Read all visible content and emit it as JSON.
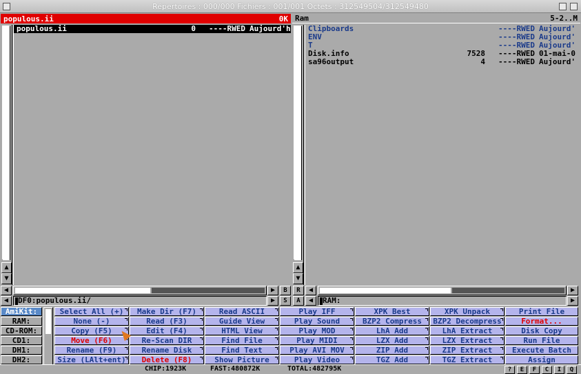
{
  "titlebar": {
    "text": "Répertoires : 000/000   Fichiers : 001/001   Octets : 312549504/312549480"
  },
  "left": {
    "title": "populous.ii",
    "size": "0K",
    "path": "DF0:populous.ii/",
    "files": [
      {
        "name": "populous.ii",
        "size": "0",
        "prot": "----RWED",
        "date": "Aujourd'h",
        "selected": true,
        "dir": false
      }
    ]
  },
  "right": {
    "title": "Ram",
    "size": "5-2..M",
    "path": "RAM:",
    "files": [
      {
        "name": "Clipboards",
        "size": "",
        "prot": "----RWED",
        "date": "Aujourd'",
        "dir": true
      },
      {
        "name": "ENV",
        "size": "",
        "prot": "----RWED",
        "date": "Aujourd'",
        "dir": true
      },
      {
        "name": "T",
        "size": "",
        "prot": "----RWED",
        "date": "Aujourd'",
        "dir": true
      },
      {
        "name": "Disk.info",
        "size": "7528",
        "prot": "----RWED",
        "date": "01-mai-0",
        "dir": false
      },
      {
        "name": "sa96output",
        "size": "4",
        "prot": "----RWED",
        "date": "Aujourd'",
        "dir": false
      }
    ]
  },
  "middle_buttons": [
    "B",
    "R",
    "S",
    "A"
  ],
  "devices": [
    "AmiKit:",
    "RAM:",
    "CD-ROM:",
    "CD1:",
    "DH1:",
    "DH2:"
  ],
  "buttons": [
    [
      "Select All (+)",
      "None (-)",
      "Copy (F5)",
      "Move (F6)",
      "Rename (F9)",
      "Size (LAlt+ent)"
    ],
    [
      "Make Dir (F7)",
      "Read (F3)",
      "Edit (F4)",
      "Re-Scan DIR",
      "Rename Disk",
      "Delete (F8)"
    ],
    [
      "Read ASCII",
      "Guide View",
      "HTML View",
      "Find File",
      "Find Text",
      "Show Picture"
    ],
    [
      "Play IFF",
      "Play Sound",
      "Play MOD",
      "Play MIDI",
      "Play AVI MOV",
      "Play Video"
    ],
    [
      "XPK Best",
      "BZP2 Compress",
      "LhA Add",
      "LZX Add",
      "ZIP Add",
      "TGZ Add"
    ],
    [
      "XPK Unpack",
      "BZP2 Decompress",
      "LhA Extract",
      "LZX Extract",
      "ZIP Extract",
      "TGZ Extract"
    ],
    [
      "Print File",
      "Format...",
      "Disk Copy",
      "Run File",
      "Execute Batch",
      "Assign"
    ]
  ],
  "button_colors": {
    "default": "#1a3a8a",
    "red": "#e00000",
    "black": "#000000",
    "bg": "#b4b4ec"
  },
  "status": {
    "chip": "CHIP:1923K",
    "fast": "FAST:480872K",
    "total": "TOTAL:482795K",
    "mini": [
      "?",
      "E",
      "F",
      "C",
      "I",
      "Q"
    ]
  }
}
